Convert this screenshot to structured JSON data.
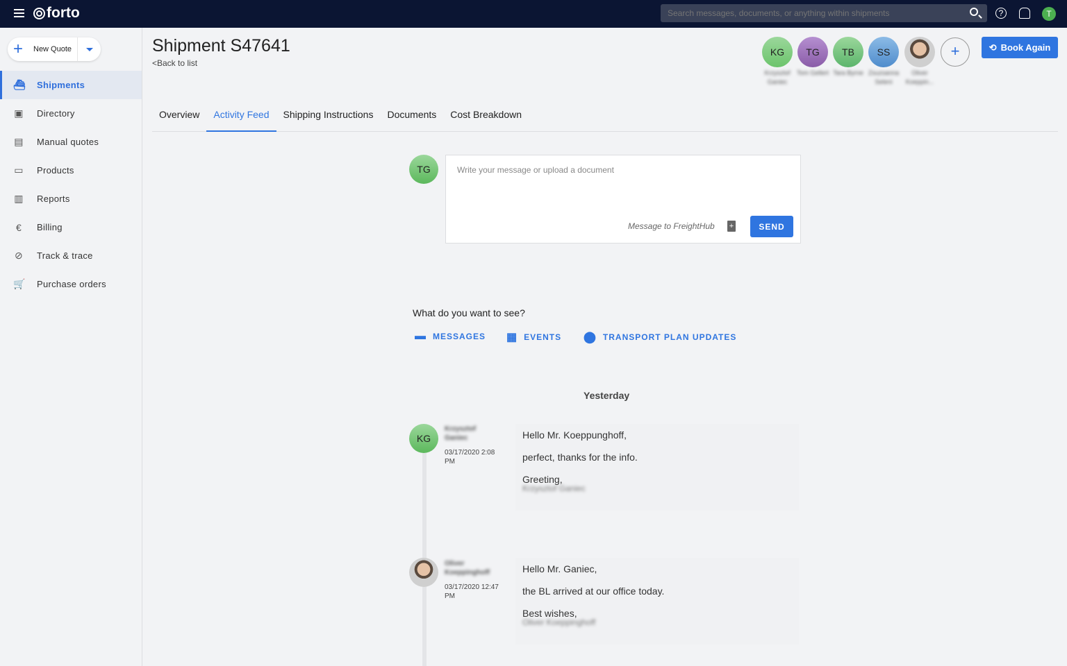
{
  "topbar": {
    "brand": "forto",
    "search_placeholder": "Search messages, documents, or anything within shipments",
    "user_initial": "T"
  },
  "sidebar": {
    "new_quote": "New Quote",
    "items": [
      {
        "label": "Shipments",
        "icon": "ship-icon",
        "active": true
      },
      {
        "label": "Directory",
        "icon": "contacts-icon"
      },
      {
        "label": "Manual quotes",
        "icon": "clipboard-icon"
      },
      {
        "label": "Products",
        "icon": "inbox-icon"
      },
      {
        "label": "Reports",
        "icon": "chart-icon"
      },
      {
        "label": "Billing",
        "icon": "euro-icon"
      },
      {
        "label": "Track & trace",
        "icon": "compass-icon"
      },
      {
        "label": "Purchase orders",
        "icon": "cart-icon"
      }
    ]
  },
  "header": {
    "title": "Shipment S47641",
    "back": "<Back to list",
    "book_again": "Book Again",
    "participants": [
      {
        "initials": "KG",
        "name": "Krzysztof Ganiec",
        "color": "#7ccf7c"
      },
      {
        "initials": "TG",
        "name": "Tom Gellert",
        "color": "#9a6bb8"
      },
      {
        "initials": "TB",
        "name": "Tara Byrne",
        "color": "#6fc47a"
      },
      {
        "initials": "SS",
        "name": "Zsuzsanna Seleni",
        "color": "#5b9bd5"
      },
      {
        "initials": "",
        "name": "Oliver Koeppin...",
        "color": "#cfcfcf"
      }
    ]
  },
  "tabs": [
    "Overview",
    "Activity Feed",
    "Shipping Instructions",
    "Documents",
    "Cost Breakdown"
  ],
  "active_tab": "Activity Feed",
  "composer": {
    "avatar": "TG",
    "placeholder": "Write your message or upload a document",
    "recipient": "Message to FreightHub",
    "send": "SEND"
  },
  "filters": {
    "question": "What do you want to see?",
    "options": [
      "MESSAGES",
      "EVENTS",
      "TRANSPORT PLAN UPDATES"
    ]
  },
  "feed": {
    "day": "Yesterday",
    "messages": [
      {
        "initials": "KG",
        "author": "Krzysztof Ganiec",
        "time": "03/17/2020 2:08 PM",
        "lines": [
          "Hello Mr. Koeppunghoff,",
          "perfect, thanks for the info.",
          "Greeting,"
        ],
        "signature": "Krzysztof Ganiec"
      },
      {
        "initials": "",
        "author": "Oliver Koeppinghoff",
        "time": "03/17/2020 12:47 PM",
        "lines": [
          "Hello Mr. Ganiec,",
          "the BL arrived at our office today.",
          "Best wishes,"
        ],
        "signature": "Oliver Koeppinghoff"
      }
    ]
  }
}
